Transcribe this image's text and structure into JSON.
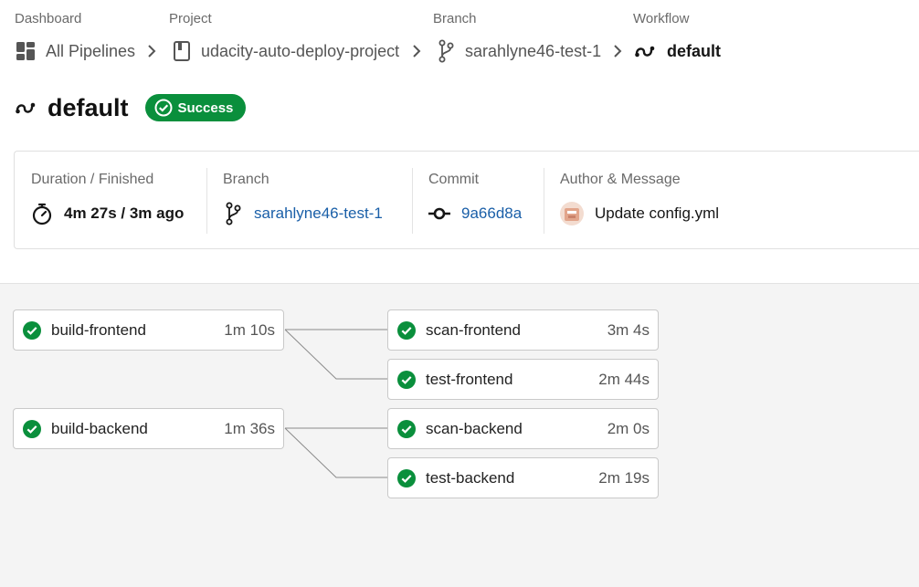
{
  "breadcrumb": {
    "labels": [
      "Dashboard",
      "Project",
      "Branch",
      "Workflow"
    ],
    "items": [
      "All Pipelines",
      "udacity-auto-deploy-project",
      "sarahlyne46-test-1",
      "default"
    ]
  },
  "workflow": {
    "name": "default",
    "status": "Success"
  },
  "summary": {
    "duration_label": "Duration / Finished",
    "duration_value": "4m 27s / 3m ago",
    "branch_label": "Branch",
    "branch_value": "sarahlyne46-test-1",
    "commit_label": "Commit",
    "commit_value": "9a66d8a",
    "author_label": "Author & Message",
    "author_message": "Update config.yml"
  },
  "jobs": [
    {
      "name": "build-frontend",
      "duration": "1m 10s",
      "status": "success"
    },
    {
      "name": "scan-frontend",
      "duration": "3m 4s",
      "status": "success"
    },
    {
      "name": "test-frontend",
      "duration": "2m 44s",
      "status": "success"
    },
    {
      "name": "build-backend",
      "duration": "1m 36s",
      "status": "success"
    },
    {
      "name": "scan-backend",
      "duration": "2m 0s",
      "status": "success"
    },
    {
      "name": "test-backend",
      "duration": "2m 19s",
      "status": "success"
    }
  ],
  "colors": {
    "success": "#0a8f3c",
    "link": "#1a5fa8"
  }
}
